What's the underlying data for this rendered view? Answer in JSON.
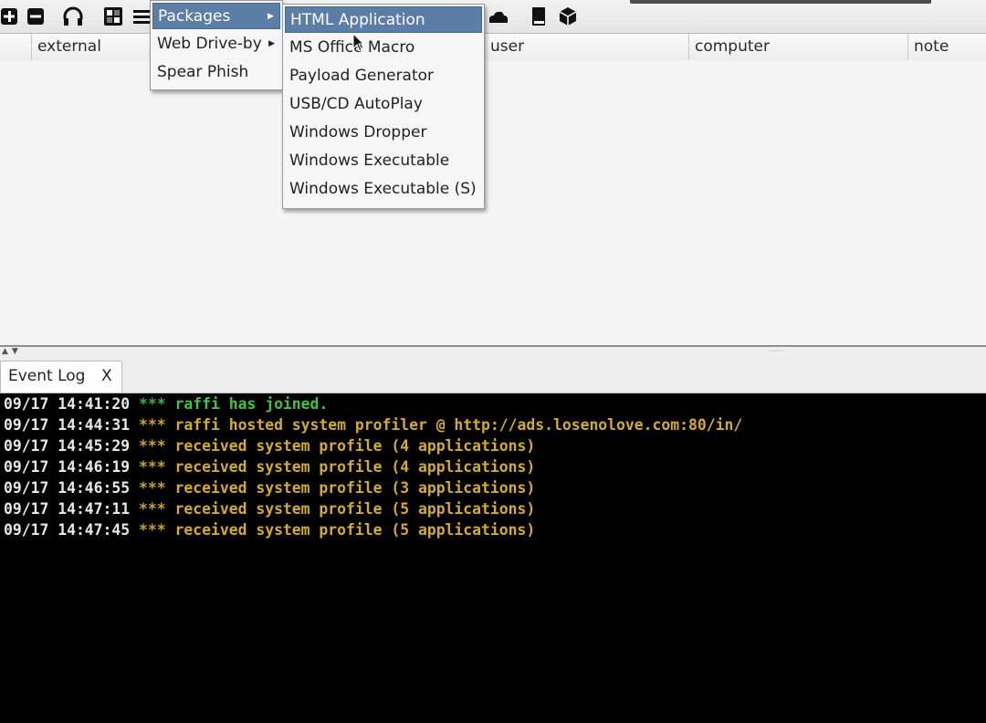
{
  "toolbar": {
    "icons": [
      "plus-icon",
      "minus-icon",
      "headphones-icon",
      "grid-icon",
      "list-icon",
      "cloud-icon",
      "book-icon",
      "cube-icon"
    ]
  },
  "table": {
    "columns": [
      "external",
      "user",
      "computer",
      "note"
    ]
  },
  "attacks_menu": {
    "items": [
      {
        "label": "Packages",
        "has_submenu": true,
        "highlighted": true
      },
      {
        "label": "Web Drive-by",
        "has_submenu": true
      },
      {
        "label": "Spear Phish",
        "has_submenu": false
      }
    ]
  },
  "packages_menu": {
    "items": [
      {
        "label": "HTML Application",
        "highlighted": true
      },
      {
        "label": "MS Office Macro"
      },
      {
        "label": "Payload Generator"
      },
      {
        "label": "USB/CD AutoPlay"
      },
      {
        "label": "Windows Dropper"
      },
      {
        "label": "Windows Executable"
      },
      {
        "label": "Windows Executable (S)"
      }
    ]
  },
  "event_log": {
    "tab_label": "Event Log",
    "close_label": "X",
    "lines": [
      {
        "timestamp": "09/17 14:41:20",
        "stars": "***",
        "message": "raffi has joined.",
        "color": "green"
      },
      {
        "timestamp": "09/17 14:44:31",
        "stars": "***",
        "message": "raffi hosted system profiler @ http://ads.losenolove.com:80/in/",
        "color": "yellow"
      },
      {
        "timestamp": "09/17 14:45:29",
        "stars": "***",
        "message": "received system profile (4 applications)",
        "color": "yellow"
      },
      {
        "timestamp": "09/17 14:46:19",
        "stars": "***",
        "message": "received system profile (4 applications)",
        "color": "yellow"
      },
      {
        "timestamp": "09/17 14:46:55",
        "stars": "***",
        "message": "received system profile (3 applications)",
        "color": "yellow"
      },
      {
        "timestamp": "09/17 14:47:11",
        "stars": "***",
        "message": "received system profile (5 applications)",
        "color": "yellow"
      },
      {
        "timestamp": "09/17 14:47:45",
        "stars": "***",
        "message": "received system profile (5 applications)",
        "color": "yellow"
      }
    ]
  },
  "colors": {
    "menu_highlight": "#5b7da6",
    "console_bg": "#000000",
    "log_green": "#45c145",
    "log_yellow": "#d3ab2e"
  }
}
